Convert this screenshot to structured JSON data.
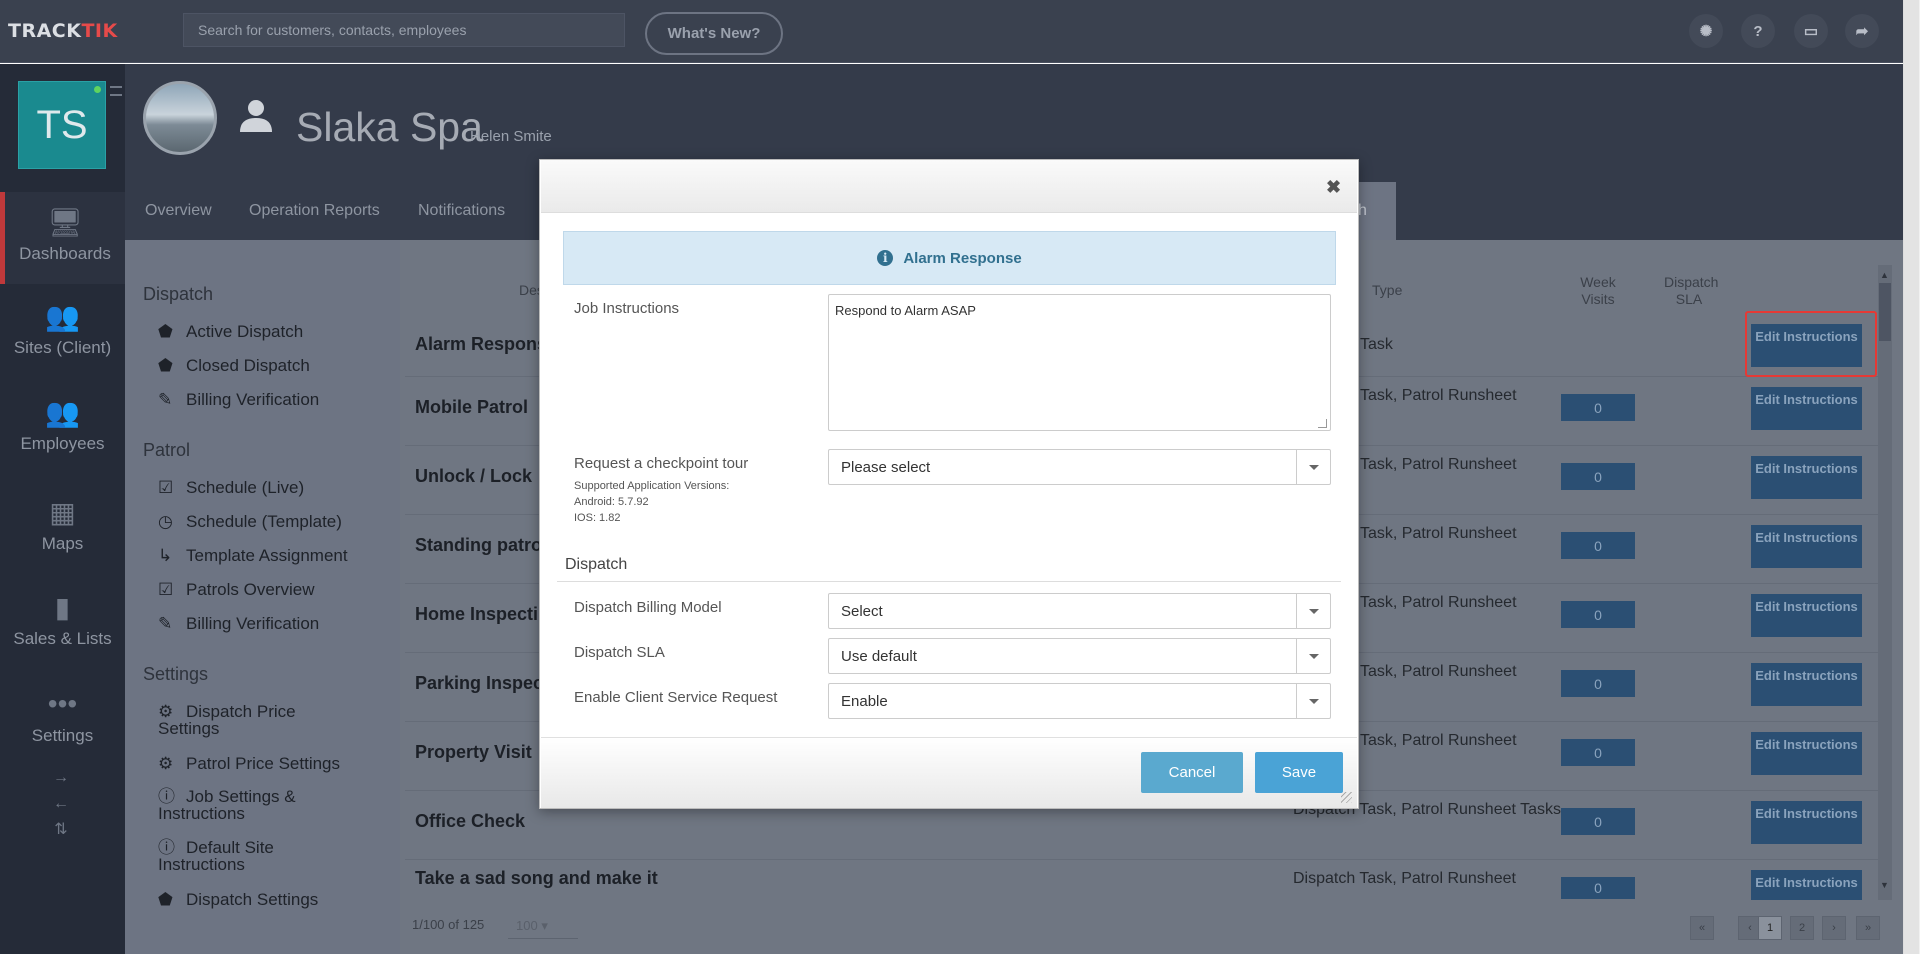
{
  "topbar": {
    "logo_track": "TRACK",
    "logo_tik": "TIK",
    "search_placeholder": "Search for customers, contacts, employees",
    "whats_new": "What's New?"
  },
  "leftnav": {
    "avatar_initials": "TS",
    "items": [
      {
        "label": "Dashboards",
        "icon": "monitor-icon"
      },
      {
        "label": "Sites (Client)",
        "icon": "sites-icon"
      },
      {
        "label": "Employees",
        "icon": "employees-icon"
      },
      {
        "label": "Maps",
        "icon": "map-icon"
      },
      {
        "label": "Sales & Lists",
        "icon": "bar-chart-icon"
      },
      {
        "label": "Settings",
        "icon": "dots-icon"
      }
    ]
  },
  "header": {
    "site_name": "Slaka Spa",
    "contact": "Helen Smite",
    "tabs": [
      "Overview",
      "Operation Reports",
      "Notifications"
    ],
    "active_tab_fragment": "ch"
  },
  "subnav": {
    "sections": [
      {
        "title": "Dispatch",
        "items": [
          "Active Dispatch",
          "Closed Dispatch",
          "Billing Verification"
        ]
      },
      {
        "title": "Patrol",
        "items": [
          "Schedule (Live)",
          "Schedule (Template)",
          "Template Assignment",
          "Patrols Overview",
          "Billing Verification"
        ]
      },
      {
        "title": "Settings",
        "items": [
          "Dispatch Price Settings",
          "Patrol Price Settings",
          "Job Settings & Instructions",
          "Default Site Instructions",
          "Dispatch Settings"
        ]
      }
    ]
  },
  "table": {
    "headers": {
      "description": "Des",
      "type": "Type",
      "week_visits": "Week Visits",
      "dispatch_sla": "Dispatch SLA"
    },
    "rows": [
      {
        "name": "Alarm Respons",
        "type": "Task",
        "count": "",
        "button": "Edit Instructions"
      },
      {
        "name": "Mobile Patrol",
        "type": "Task, Patrol Runsheet",
        "count": "0",
        "button": "Edit Instructions"
      },
      {
        "name": "Unlock / Lock",
        "type": "Task, Patrol Runsheet",
        "count": "0",
        "button": "Edit Instructions"
      },
      {
        "name": "Standing patrol",
        "type": "Task, Patrol Runsheet",
        "count": "0",
        "button": "Edit Instructions"
      },
      {
        "name": "Home Inspecti",
        "type": "Task, Patrol Runsheet",
        "count": "0",
        "button": "Edit Instructions"
      },
      {
        "name": "Parking Inspec",
        "type": "Task, Patrol Runsheet",
        "count": "0",
        "button": "Edit Instructions"
      },
      {
        "name": "Property Visit",
        "type": "Task, Patrol Runsheet",
        "count": "0",
        "button": "Edit Instructions"
      },
      {
        "name": "Office Check",
        "type": "Dispatch Task, Patrol Runsheet Tasks",
        "count": "0",
        "button": "Edit Instructions"
      },
      {
        "name": "Take a sad song and make it",
        "type": "Dispatch Task, Patrol Runsheet",
        "count": "0",
        "button": "Edit Instructions"
      }
    ],
    "pagination_info": "1/100 of 125",
    "page_size": "100",
    "pages": [
      "1",
      "2"
    ]
  },
  "modal": {
    "banner": "Alarm Response",
    "job_instructions_label": "Job Instructions",
    "job_instructions_value": "Respond to Alarm ASAP",
    "checkpoint_label": "Request a checkpoint tour",
    "checkpoint_value": "Please select",
    "supported_title": "Supported Application Versions:",
    "android": "Android: 5.7.92",
    "ios": "IOS: 1.82",
    "section_dispatch": "Dispatch",
    "billing_label": "Dispatch Billing Model",
    "billing_value": "Select",
    "sla_label": "Dispatch SLA",
    "sla_value": "Use default",
    "csr_label": "Enable Client Service Request",
    "csr_value": "Enable",
    "cancel": "Cancel",
    "save": "Save",
    "colors": {
      "cancel": "#5aa9cf",
      "save": "#4aa3d6"
    }
  }
}
